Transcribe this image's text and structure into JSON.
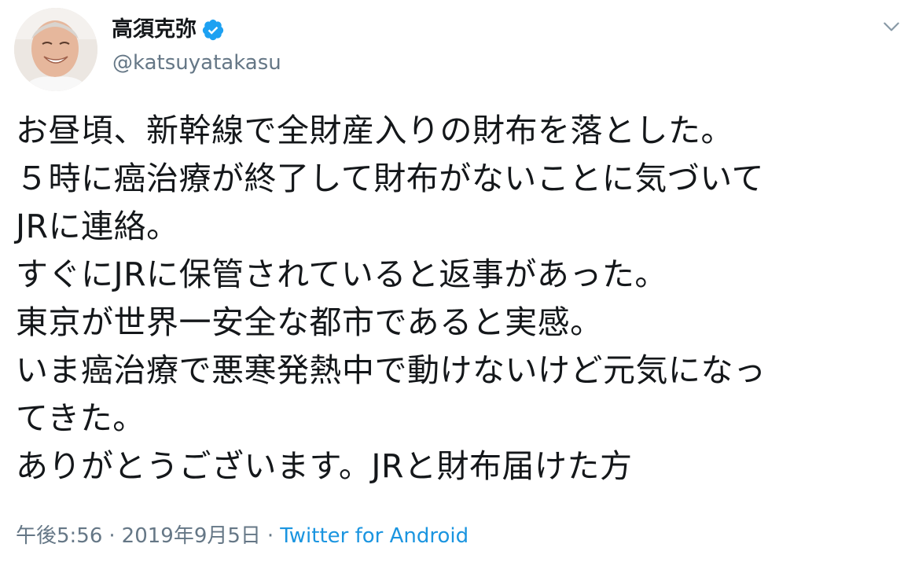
{
  "user": {
    "display_name": "高須克弥",
    "screen_name": "@katsuyatakasu",
    "verified_icon": "verified-badge-icon",
    "avatar": "avatar-photo"
  },
  "menu": {
    "icon": "chevron-down-icon"
  },
  "tweet": {
    "lines": [
      "お昼頃、新幹線で全財産入りの財布を落とした。",
      "５時に癌治療が終了して財布がないことに気づいて",
      "JRに連絡。",
      "すぐにJRに保管されていると返事があった。",
      "東京が世界一安全な都市であると実感。",
      "いま癌治療で悪寒発熱中で動けないけど元気になっ",
      "てきた。",
      "ありがとうございます。JRと財布届けた方"
    ]
  },
  "meta": {
    "time": "午後5:56",
    "separator": "·",
    "date": "2019年9月5日",
    "source": "Twitter for Android"
  },
  "colors": {
    "text": "#14171a",
    "secondary": "#657786",
    "link": "#1b95e0",
    "verified": "#1da1f2"
  }
}
